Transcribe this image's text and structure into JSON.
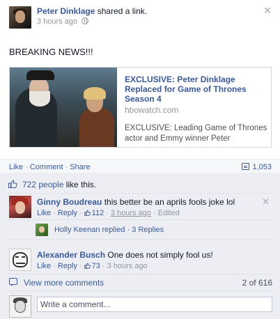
{
  "post": {
    "author": "Peter Dinklage",
    "action": "shared a link.",
    "time": "3 hours ago",
    "status": "BREAKING NEWS!!!"
  },
  "link_card": {
    "title": "EXCLUSIVE: Peter Dinklage Replaced for Game of Thrones Season 4",
    "domain": "hbowatch.com",
    "description": "EXCLUSIVE: Leading Game of Thrones actor and Emmy winner Peter"
  },
  "actions": {
    "like": "Like",
    "comment": "Comment",
    "share": "Share",
    "share_count": "1,053"
  },
  "likes": {
    "people": "722 people",
    "suffix": " like this."
  },
  "comments": [
    {
      "name": "Ginny Boudreau",
      "text": "this better be an aprils fools joke lol",
      "like": "Like",
      "reply": "Reply",
      "like_count": "112",
      "time": "3 hours ago",
      "edited": "Edited"
    },
    {
      "name": "Alexander Busch",
      "text": "One does not simply fool us!",
      "like": "Like",
      "reply": "Reply",
      "like_count": "73",
      "time": "3 hours ago"
    }
  ],
  "reply_summary": {
    "name": "Holly Keenan",
    "text": " replied · 3 Replies"
  },
  "more_comments": {
    "label": "View more comments",
    "count": "2 of 616"
  },
  "write_comment": {
    "placeholder": "Write a comment..."
  },
  "icons": {
    "privacy": "globe-icon",
    "close": "close-icon",
    "like": "thumbs-up-icon",
    "share": "share-icon",
    "comment": "comment-bubble-icon"
  },
  "colors": {
    "link": "#3b5998",
    "meta": "#90949c",
    "feedback_bg": "#eceef3"
  }
}
